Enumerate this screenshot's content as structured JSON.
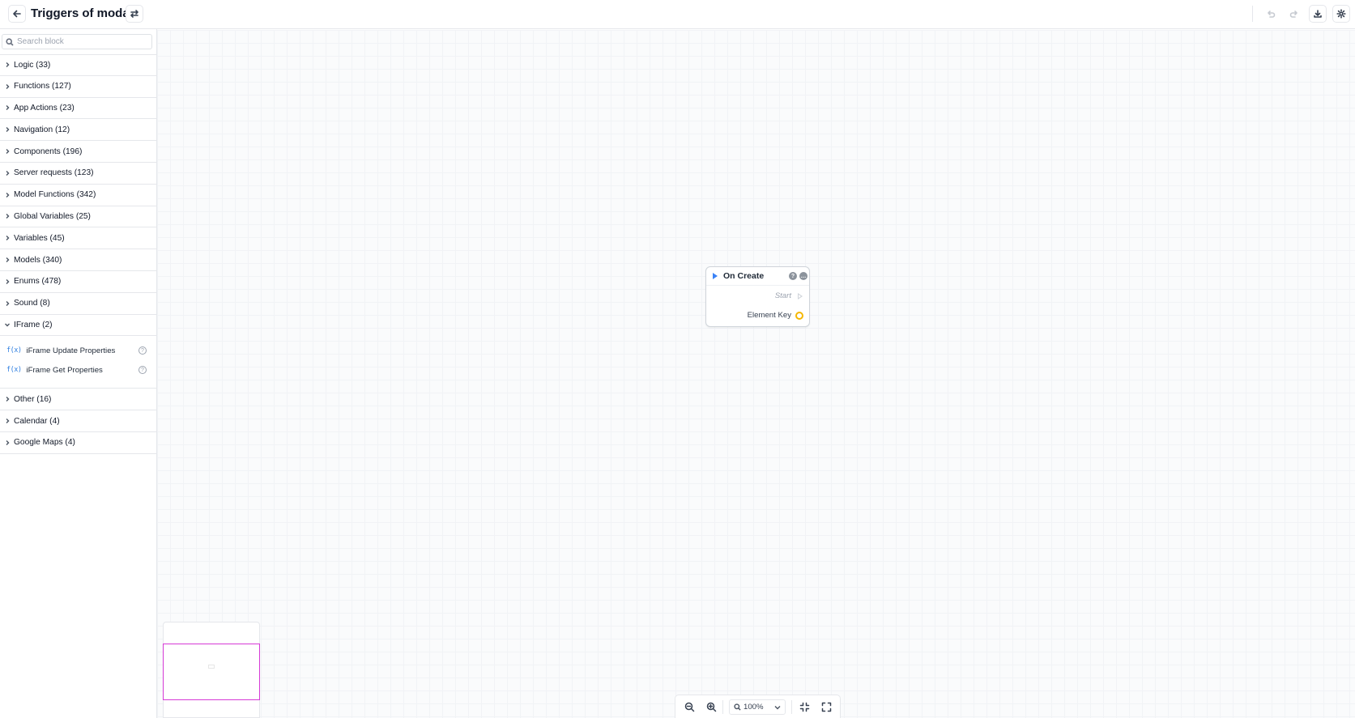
{
  "header": {
    "title": "Triggers of modal",
    "back_icon": "arrow-left-icon",
    "switch_icon": "swap-icon",
    "undo_icon": "undo-icon",
    "redo_icon": "redo-icon",
    "download_icon": "download-icon",
    "settings_icon": "gear-icon"
  },
  "sidebar": {
    "search_placeholder": "Search block",
    "categories_before": [
      {
        "label": "Logic (33)"
      },
      {
        "label": "Functions (127)"
      },
      {
        "label": "App Actions (23)"
      },
      {
        "label": "Navigation (12)"
      },
      {
        "label": "Components (196)"
      },
      {
        "label": "Server requests (123)"
      },
      {
        "label": "Model Functions (342)"
      },
      {
        "label": "Global Variables (25)"
      },
      {
        "label": "Variables (45)"
      },
      {
        "label": "Models (340)"
      },
      {
        "label": "Enums (478)"
      },
      {
        "label": "Sound (8)"
      }
    ],
    "expanded_category": {
      "label": "IFrame (2)",
      "items": [
        {
          "icon_text": "f(x)",
          "label": "iFrame Update Properties",
          "help": "?"
        },
        {
          "icon_text": "f(x)",
          "label": "iFrame Get Properties",
          "help": "?"
        }
      ]
    },
    "categories_after": [
      {
        "label": "Other (16)"
      },
      {
        "label": "Calendar (4)"
      },
      {
        "label": "Google Maps (4)"
      }
    ]
  },
  "node": {
    "title": "On Create",
    "help_icon_text": "?",
    "output_start": "Start",
    "output_key": "Element Key",
    "port_color": "#f5b700",
    "exec_color": "#3b82f6"
  },
  "zoom": {
    "value": "100%"
  },
  "colors": {
    "minimap_viewport": "#d63ad6",
    "accent_blue": "#2f7fe0"
  }
}
